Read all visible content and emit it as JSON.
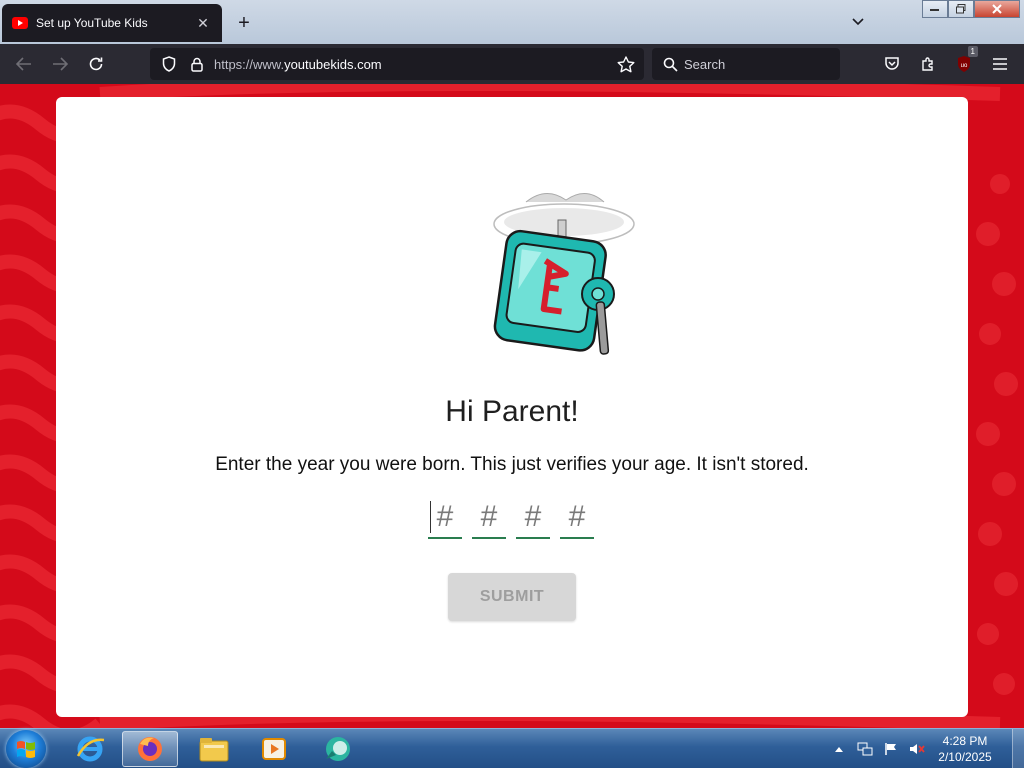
{
  "browser": {
    "tab_title": "Set up YouTube Kids",
    "tab_close_glyph": "✕",
    "new_tab_glyph": "+",
    "url_prefix": "https://www.",
    "url_domain": "youtubekids.com",
    "search_placeholder": "Search",
    "extension_badge": "1"
  },
  "page": {
    "heading": "Hi Parent!",
    "instruction": "Enter the year you were born. This just verifies your age. It isn't stored.",
    "digit_placeholders": [
      "#",
      "#",
      "#",
      "#"
    ],
    "submit_label": "SUBMIT",
    "submit_enabled": false,
    "brand_red": "#d40a1a"
  },
  "taskbar": {
    "time": "4:28 PM",
    "date": "2/10/2025",
    "pinned": [
      "internet-explorer-icon",
      "firefox-icon",
      "file-explorer-icon",
      "media-player-icon",
      "app-icon"
    ]
  }
}
